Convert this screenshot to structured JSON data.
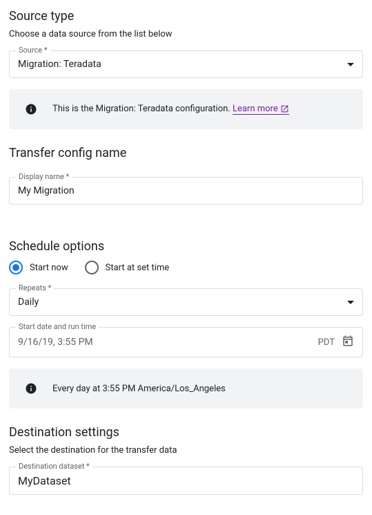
{
  "sourceType": {
    "title": "Source type",
    "desc": "Choose a data source from the list below",
    "field": {
      "label": "Source *",
      "value": "Migration: Teradata"
    },
    "info": {
      "text": "This is the Migration: Teradata configuration. ",
      "link": "Learn more"
    }
  },
  "transferConfig": {
    "title": "Transfer config name",
    "field": {
      "label": "Display name *",
      "value": "My Migration"
    }
  },
  "schedule": {
    "title": "Schedule options",
    "radios": {
      "startNow": "Start now",
      "startAtSet": "Start at set time"
    },
    "repeats": {
      "label": "Repeats *",
      "value": "Daily"
    },
    "datetime": {
      "label": "Start date and run time",
      "value": "9/16/19, 3:55 PM",
      "tz": "PDT"
    },
    "info": {
      "text": "Every day at 3:55 PM America/Los_Angeles"
    }
  },
  "destination": {
    "title": "Destination settings",
    "desc": "Select the destination for the transfer data",
    "field": {
      "label": "Destination dataset *",
      "value": "MyDataset"
    }
  }
}
